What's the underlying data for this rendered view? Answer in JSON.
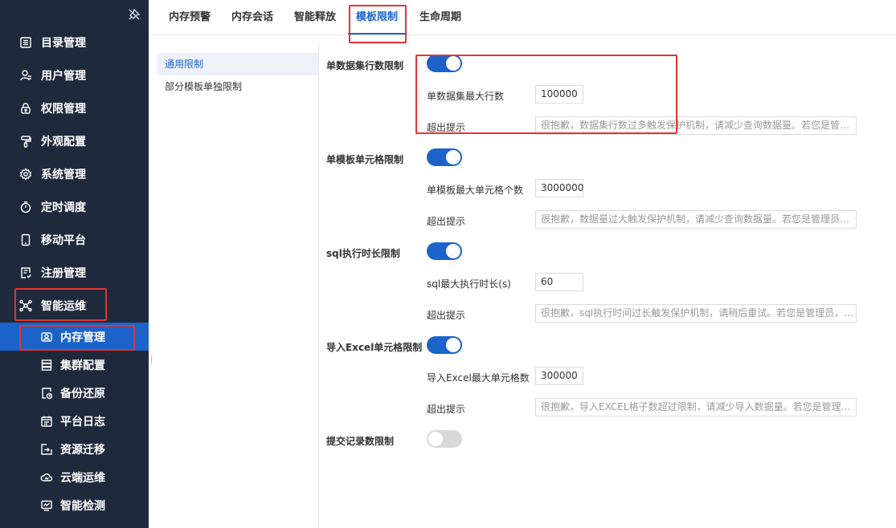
{
  "sidebar": {
    "items": [
      {
        "label": "目录管理",
        "icon": "list-icon"
      },
      {
        "label": "用户管理",
        "icon": "user-icon"
      },
      {
        "label": "权限管理",
        "icon": "lock-icon"
      },
      {
        "label": "外观配置",
        "icon": "paint-roller-icon"
      },
      {
        "label": "系统管理",
        "icon": "gear-icon"
      },
      {
        "label": "定时调度",
        "icon": "timer-icon"
      },
      {
        "label": "移动平台",
        "icon": "mobile-icon"
      },
      {
        "label": "注册管理",
        "icon": "register-icon"
      },
      {
        "label": "智能运维",
        "icon": "network-icon"
      }
    ],
    "subitems": [
      {
        "label": "内存管理",
        "icon": "memory-icon",
        "active": true
      },
      {
        "label": "集群配置",
        "icon": "server-icon"
      },
      {
        "label": "备份还原",
        "icon": "backup-icon"
      },
      {
        "label": "平台日志",
        "icon": "log-icon"
      },
      {
        "label": "资源迁移",
        "icon": "migrate-icon"
      },
      {
        "label": "云端运维",
        "icon": "cloud-icon"
      },
      {
        "label": "智能检测",
        "icon": "monitor-icon"
      }
    ]
  },
  "tabs": [
    {
      "label": "内存预警"
    },
    {
      "label": "内存会话"
    },
    {
      "label": "智能释放"
    },
    {
      "label": "模板限制",
      "active": true
    },
    {
      "label": "生命周期"
    }
  ],
  "submenu": [
    {
      "label": "通用限制",
      "active": true
    },
    {
      "label": "部分模板单独限制"
    }
  ],
  "sections": [
    {
      "title": "单数据集行数限制",
      "enabled": true,
      "limit_label": "单数据集最大行数",
      "limit_value": "100000",
      "msg_label": "超出提示",
      "msg_value": "很抱歉，数据集行数过多触发保护机制，请减少查询数据量。若您是管理员，可在智能运维-内存管理中调整。"
    },
    {
      "title": "单模板单元格限制",
      "enabled": true,
      "limit_label": "单模板最大单元格个数",
      "limit_value": "3000000",
      "msg_label": "超出提示",
      "msg_value": "很抱歉，数据量过大触发保护机制，请减少查询数据量。若您是管理员，可在智能运维-内存管理中调整。"
    },
    {
      "title": "sql执行时长限制",
      "enabled": true,
      "limit_label": "sql最大执行时长(s)",
      "limit_value": "60",
      "msg_label": "超出提示",
      "msg_value": "很抱歉，sql执行时间过长触发保护机制，请稍后重试。若您是管理员，可在智能运维-内存管理中调整。"
    },
    {
      "title": "导入Excel单元格限制",
      "enabled": true,
      "limit_label": "导入Excel最大单元格数",
      "limit_value": "300000",
      "msg_label": "超出提示",
      "msg_value": "很抱歉，导入EXCEL格子数超过限制，请减少导入数据量。若您是管理员，可在智能运维-内存管理中调整。"
    },
    {
      "title": "提交记录数限制",
      "enabled": false
    }
  ],
  "colors": {
    "sidebar_bg": "#1e2a3b",
    "accent": "#1b63c9",
    "highlight": "#e53333"
  }
}
